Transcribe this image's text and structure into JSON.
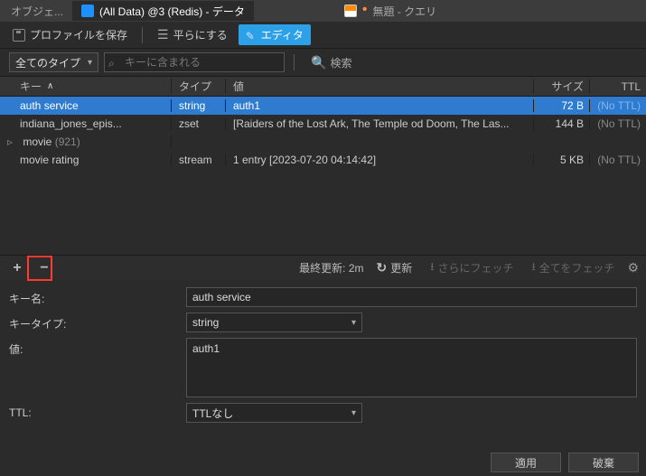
{
  "tabs": {
    "prev_label": "オブジェ...",
    "main_label": "(All Data) @3 (Redis) - データ",
    "other_label": "無題 - クエリ"
  },
  "toolbar": {
    "save_profile": "プロファイルを保存",
    "flatten": "平らにする",
    "editor": "エディタ"
  },
  "filter": {
    "type_label": "全てのタイプ",
    "search_placeholder": "キーに含まれる",
    "search_button": "検索"
  },
  "table": {
    "headers": {
      "key": "キー",
      "type": "タイプ",
      "value": "値",
      "size": "サイズ",
      "ttl": "TTL"
    },
    "rows": [
      {
        "key": "auth service",
        "type": "string",
        "value": "auth1",
        "size": "72 B",
        "ttl": "(No TTL)",
        "selected": true,
        "expandable": false
      },
      {
        "key": "indiana_jones_epis...",
        "type": "zset",
        "value": "[Raiders of the Lost Ark, The Temple od Doom, The Las...",
        "size": "144 B",
        "ttl": "(No TTL)",
        "selected": false,
        "expandable": false
      },
      {
        "key": "movie",
        "count": "(921)",
        "type": "",
        "value": "",
        "size": "",
        "ttl": "",
        "selected": false,
        "expandable": true
      },
      {
        "key": "movie rating",
        "type": "stream",
        "value": "1 entry [2023-07-20 04:14:42]",
        "size": "5 KB",
        "ttl": "(No TTL)",
        "selected": false,
        "expandable": false
      }
    ]
  },
  "midbar": {
    "last_update_label": "最終更新:",
    "last_update_value": "2m",
    "refresh": "更新",
    "fetch_more": "さらにフェッチ",
    "fetch_all": "全てをフェッチ"
  },
  "details": {
    "key_label": "キー名:",
    "key_value": "auth service",
    "type_label": "キータイプ:",
    "type_value": "string",
    "value_label": "値:",
    "value_value": "auth1",
    "ttl_label": "TTL:",
    "ttl_value": "TTLなし"
  },
  "buttons": {
    "apply": "適用",
    "discard": "破棄"
  }
}
